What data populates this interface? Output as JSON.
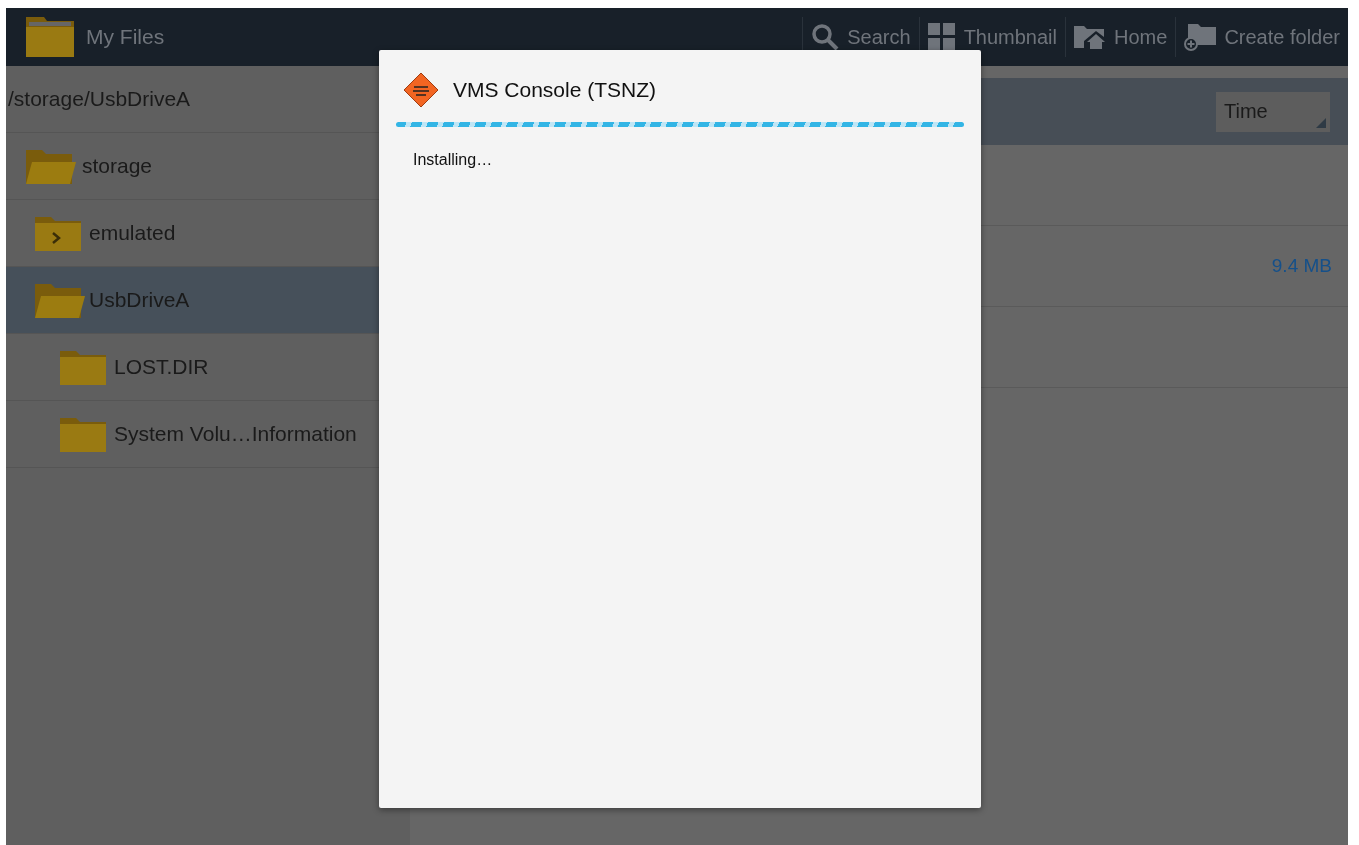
{
  "action_bar": {
    "title": "My Files",
    "actions": [
      {
        "kind": "search",
        "label": "Search"
      },
      {
        "kind": "thumbnail",
        "label": "Thumbnail"
      },
      {
        "kind": "home",
        "label": "Home"
      },
      {
        "kind": "create_folder",
        "label": "Create folder"
      }
    ]
  },
  "path": "/storage/UsbDriveA",
  "tree": [
    {
      "label": "storage",
      "selected": false,
      "children": [
        {
          "label": "emulated",
          "selected": false,
          "link": true
        },
        {
          "label": "UsbDriveA",
          "selected": true,
          "children": [
            {
              "label": "LOST.DIR",
              "selected": false
            },
            {
              "label": "System Volu…Information",
              "selected": false
            }
          ]
        }
      ]
    }
  ],
  "sort": {
    "value": "Time"
  },
  "files": [
    {
      "size": "9.4 MB"
    }
  ],
  "dialog": {
    "title": "VMS Console (TSNZ)",
    "progress": {
      "indeterminate": true
    },
    "message": "Installing…"
  }
}
